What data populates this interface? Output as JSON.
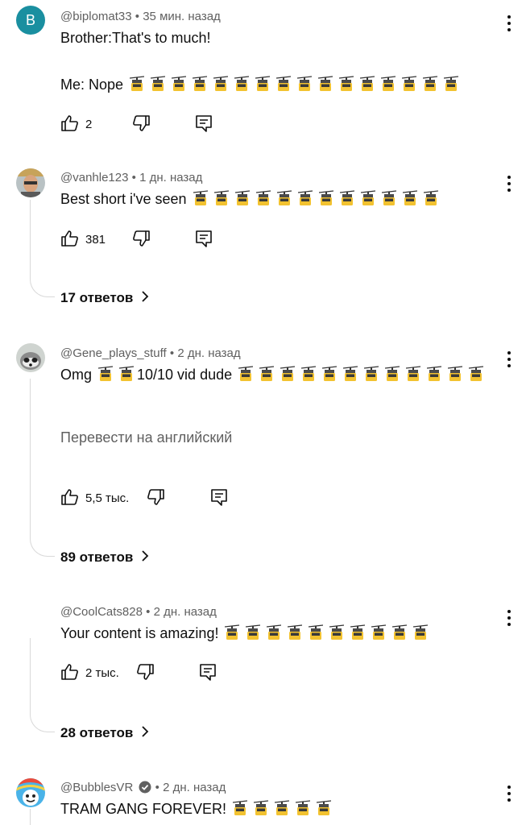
{
  "comments": [
    {
      "author": "@biplomat33",
      "time": "35 мин. назад",
      "text_line1": "Brother:That's to much!",
      "text_line2": "Me: Nope",
      "likes": "2",
      "avatar_letter": "B",
      "avatar_color": "#1a8fa0"
    },
    {
      "author": "@vanhle123",
      "time": "1 дн. назад",
      "text": "Best short i've seen",
      "likes": "381",
      "replies": "17 ответов"
    },
    {
      "author": "@Gene_plays_stuff",
      "time": "2 дн. назад",
      "text_a": "Omg",
      "text_b": "10/10 vid dude",
      "translate": "Перевести на английский",
      "likes": "5,5 тыс.",
      "replies": "89 ответов"
    },
    {
      "author": "@CoolCats828",
      "time": "2 дн. назад",
      "text": "Your content is amazing!",
      "likes": "2 тыс.",
      "replies": "28 ответов"
    },
    {
      "author": "@BubblesVR",
      "time": "2 дн. назад",
      "text": "TRAM GANG FOREVER!",
      "verified": true
    }
  ],
  "icons": {
    "emoji": "aerial-tramway-emoji",
    "like": "thumbs-up-icon",
    "dislike": "thumbs-down-icon",
    "reply": "reply-icon",
    "more": "more-vertical-icon",
    "chevron": "chevron-right-icon"
  },
  "separator": "•"
}
